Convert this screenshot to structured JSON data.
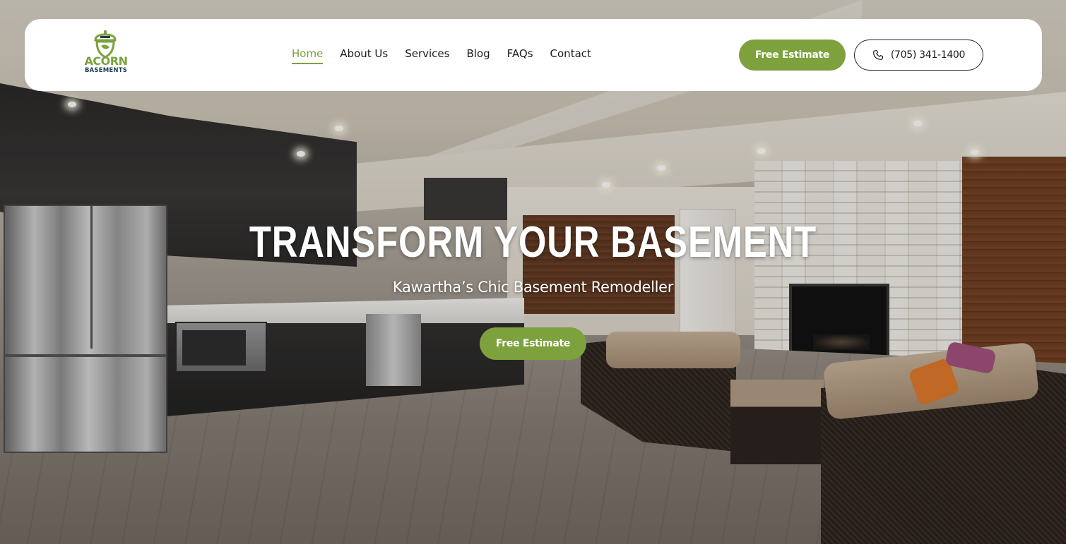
{
  "brand": {
    "name_line1": "ACORN",
    "name_line2": "BASEMENTS",
    "primary_color": "#7da13c",
    "secondary_color": "#1d3b52",
    "logo_icon": "acorn-icon"
  },
  "nav": {
    "items": [
      {
        "label": "Home",
        "active": true
      },
      {
        "label": "About Us",
        "active": false
      },
      {
        "label": "Services",
        "active": false
      },
      {
        "label": "Blog",
        "active": false
      },
      {
        "label": "FAQs",
        "active": false
      },
      {
        "label": "Contact",
        "active": false
      }
    ]
  },
  "header_actions": {
    "estimate_label": "Free Estimate",
    "phone_label": "(705) 341-1400",
    "phone_icon": "phone-icon"
  },
  "hero": {
    "title": "TRANSFORM YOUR BASEMENT",
    "subtitle": "Kawartha’s Chic Basement Remodeller",
    "cta_label": "Free Estimate",
    "background": "finished-basement-photo"
  }
}
